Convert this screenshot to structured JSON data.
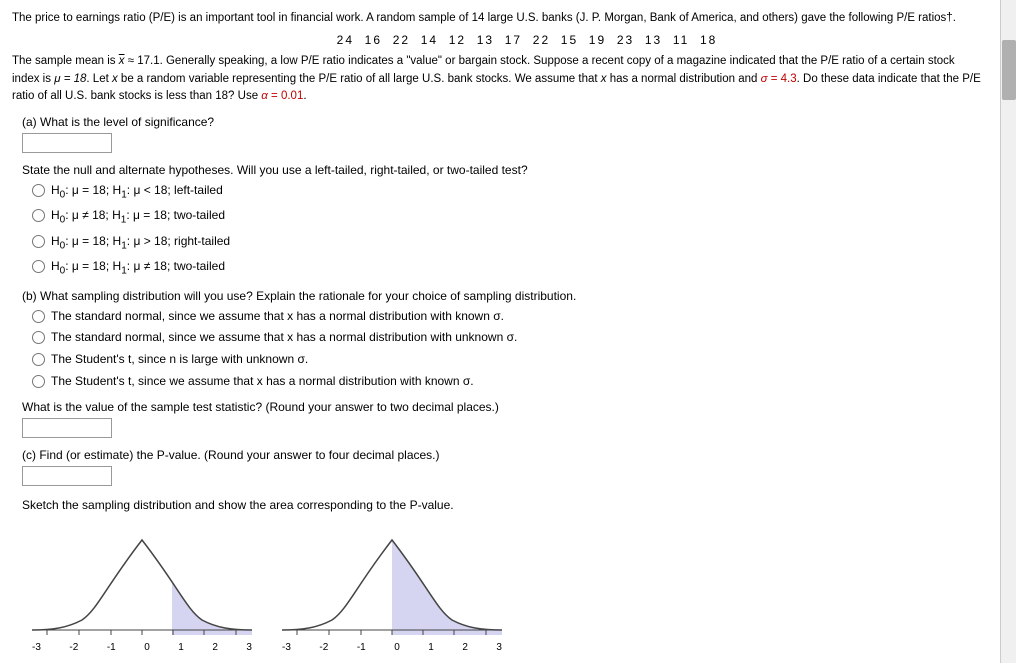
{
  "intro": {
    "paragraph1": "The price to earnings ratio (P/E) is an important tool in financial work. A random sample of 14 large U.S. banks (J. P. Morgan, Bank of America, and others) gave the following P/E ratios†.",
    "data_row": "24  16  22  14  12  13  17  22  15  19  23  13  11  18",
    "paragraph2_parts": [
      "The sample mean is ",
      "x",
      " ≈ 17.1. Generally speaking, a low P/E ratio indicates a \"value\" or bargain stock. Suppose a recent copy of a magazine indicated that the P/E ratio of a certain stock index is ",
      "μ = 18",
      ". Let x be a random variable representing the P/E ratio of all large U.S. bank stocks. We assume that x has a normal distribution and ",
      "σ = 4.3",
      ". Do these data indicate that the P/E ratio of all U.S. bank stocks is less than 18? Use ",
      "α = 0.01",
      "."
    ]
  },
  "part_a": {
    "label": "(a) What is the level of significance?",
    "input_placeholder": ""
  },
  "hypothesis": {
    "label": "State the null and alternate hypotheses. Will you use a left-tailed, right-tailed, or two-tailed test?",
    "options": [
      {
        "id": "h1",
        "text": "H₀: μ = 18; H₁: μ < 18; left-tailed"
      },
      {
        "id": "h2",
        "text": "H₀: μ ≠ 18; H₁: μ = 18; two-tailed"
      },
      {
        "id": "h3",
        "text": "H₀: μ = 18; H₁: μ > 18; right-tailed"
      },
      {
        "id": "h4",
        "text": "H₀: μ = 18; H₁: μ ≠ 18; two-tailed"
      }
    ]
  },
  "part_b": {
    "label": "(b) What sampling distribution will you use? Explain the rationale for your choice of sampling distribution.",
    "options": [
      {
        "id": "b1",
        "text": "The standard normal, since we assume that x has a normal distribution with known σ."
      },
      {
        "id": "b2",
        "text": "The standard normal, since we assume that x has a normal distribution with unknown σ."
      },
      {
        "id": "b3",
        "text": "The Student's t, since n is large with unknown σ."
      },
      {
        "id": "b4",
        "text": "The Student's t, since we assume that x has a normal distribution with known σ."
      }
    ]
  },
  "sample_stat": {
    "label": "What is the value of the sample test statistic? (Round your answer to two decimal places.)",
    "input_placeholder": ""
  },
  "part_c": {
    "label": "(c) Find (or estimate) the P-value. (Round your answer to four decimal places.)",
    "input_placeholder": ""
  },
  "sketch": {
    "label": "Sketch the sampling distribution and show the area corresponding to the P-value."
  },
  "charts": {
    "left": {
      "axis_labels": [
        "-3",
        "-2",
        "-1",
        "0",
        "1",
        "2",
        "3"
      ],
      "shaded_from": 0.5,
      "shaded_to": 1.0
    },
    "right": {
      "axis_labels": [
        "-3",
        "-2",
        "-1",
        "0",
        "1",
        "2",
        "3"
      ],
      "shaded_from": 0.7,
      "shaded_to": 1.0
    }
  }
}
